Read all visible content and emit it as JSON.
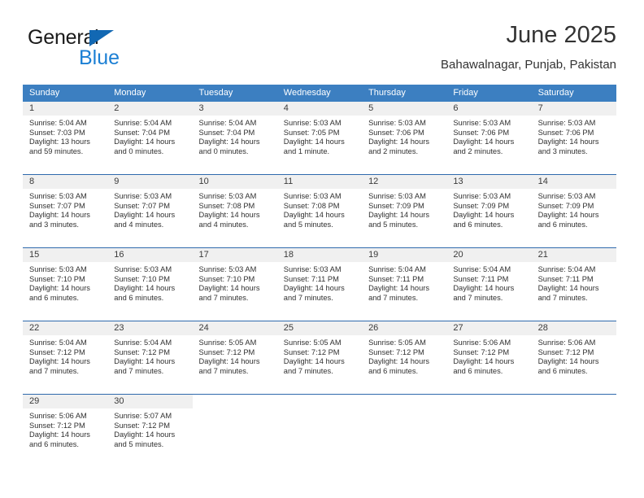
{
  "brand": {
    "name_part1": "General",
    "name_part2": "Blue",
    "triangle_color": "#1268b3",
    "blue_color": "#1b7fd4"
  },
  "header": {
    "title": "June 2025",
    "subtitle": "Bahawalnagar, Punjab, Pakistan"
  },
  "theme": {
    "header_bg": "#3c7fc1",
    "row_divider": "#2f6aad",
    "daynum_band": "#f0f0f0"
  },
  "weekdays": [
    "Sunday",
    "Monday",
    "Tuesday",
    "Wednesday",
    "Thursday",
    "Friday",
    "Saturday"
  ],
  "weeks": [
    [
      {
        "day": "1",
        "sunrise": "Sunrise: 5:04 AM",
        "sunset": "Sunset: 7:03 PM",
        "daylight1": "Daylight: 13 hours",
        "daylight2": "and 59 minutes."
      },
      {
        "day": "2",
        "sunrise": "Sunrise: 5:04 AM",
        "sunset": "Sunset: 7:04 PM",
        "daylight1": "Daylight: 14 hours",
        "daylight2": "and 0 minutes."
      },
      {
        "day": "3",
        "sunrise": "Sunrise: 5:04 AM",
        "sunset": "Sunset: 7:04 PM",
        "daylight1": "Daylight: 14 hours",
        "daylight2": "and 0 minutes."
      },
      {
        "day": "4",
        "sunrise": "Sunrise: 5:03 AM",
        "sunset": "Sunset: 7:05 PM",
        "daylight1": "Daylight: 14 hours",
        "daylight2": "and 1 minute."
      },
      {
        "day": "5",
        "sunrise": "Sunrise: 5:03 AM",
        "sunset": "Sunset: 7:06 PM",
        "daylight1": "Daylight: 14 hours",
        "daylight2": "and 2 minutes."
      },
      {
        "day": "6",
        "sunrise": "Sunrise: 5:03 AM",
        "sunset": "Sunset: 7:06 PM",
        "daylight1": "Daylight: 14 hours",
        "daylight2": "and 2 minutes."
      },
      {
        "day": "7",
        "sunrise": "Sunrise: 5:03 AM",
        "sunset": "Sunset: 7:06 PM",
        "daylight1": "Daylight: 14 hours",
        "daylight2": "and 3 minutes."
      }
    ],
    [
      {
        "day": "8",
        "sunrise": "Sunrise: 5:03 AM",
        "sunset": "Sunset: 7:07 PM",
        "daylight1": "Daylight: 14 hours",
        "daylight2": "and 3 minutes."
      },
      {
        "day": "9",
        "sunrise": "Sunrise: 5:03 AM",
        "sunset": "Sunset: 7:07 PM",
        "daylight1": "Daylight: 14 hours",
        "daylight2": "and 4 minutes."
      },
      {
        "day": "10",
        "sunrise": "Sunrise: 5:03 AM",
        "sunset": "Sunset: 7:08 PM",
        "daylight1": "Daylight: 14 hours",
        "daylight2": "and 4 minutes."
      },
      {
        "day": "11",
        "sunrise": "Sunrise: 5:03 AM",
        "sunset": "Sunset: 7:08 PM",
        "daylight1": "Daylight: 14 hours",
        "daylight2": "and 5 minutes."
      },
      {
        "day": "12",
        "sunrise": "Sunrise: 5:03 AM",
        "sunset": "Sunset: 7:09 PM",
        "daylight1": "Daylight: 14 hours",
        "daylight2": "and 5 minutes."
      },
      {
        "day": "13",
        "sunrise": "Sunrise: 5:03 AM",
        "sunset": "Sunset: 7:09 PM",
        "daylight1": "Daylight: 14 hours",
        "daylight2": "and 6 minutes."
      },
      {
        "day": "14",
        "sunrise": "Sunrise: 5:03 AM",
        "sunset": "Sunset: 7:09 PM",
        "daylight1": "Daylight: 14 hours",
        "daylight2": "and 6 minutes."
      }
    ],
    [
      {
        "day": "15",
        "sunrise": "Sunrise: 5:03 AM",
        "sunset": "Sunset: 7:10 PM",
        "daylight1": "Daylight: 14 hours",
        "daylight2": "and 6 minutes."
      },
      {
        "day": "16",
        "sunrise": "Sunrise: 5:03 AM",
        "sunset": "Sunset: 7:10 PM",
        "daylight1": "Daylight: 14 hours",
        "daylight2": "and 6 minutes."
      },
      {
        "day": "17",
        "sunrise": "Sunrise: 5:03 AM",
        "sunset": "Sunset: 7:10 PM",
        "daylight1": "Daylight: 14 hours",
        "daylight2": "and 7 minutes."
      },
      {
        "day": "18",
        "sunrise": "Sunrise: 5:03 AM",
        "sunset": "Sunset: 7:11 PM",
        "daylight1": "Daylight: 14 hours",
        "daylight2": "and 7 minutes."
      },
      {
        "day": "19",
        "sunrise": "Sunrise: 5:04 AM",
        "sunset": "Sunset: 7:11 PM",
        "daylight1": "Daylight: 14 hours",
        "daylight2": "and 7 minutes."
      },
      {
        "day": "20",
        "sunrise": "Sunrise: 5:04 AM",
        "sunset": "Sunset: 7:11 PM",
        "daylight1": "Daylight: 14 hours",
        "daylight2": "and 7 minutes."
      },
      {
        "day": "21",
        "sunrise": "Sunrise: 5:04 AM",
        "sunset": "Sunset: 7:11 PM",
        "daylight1": "Daylight: 14 hours",
        "daylight2": "and 7 minutes."
      }
    ],
    [
      {
        "day": "22",
        "sunrise": "Sunrise: 5:04 AM",
        "sunset": "Sunset: 7:12 PM",
        "daylight1": "Daylight: 14 hours",
        "daylight2": "and 7 minutes."
      },
      {
        "day": "23",
        "sunrise": "Sunrise: 5:04 AM",
        "sunset": "Sunset: 7:12 PM",
        "daylight1": "Daylight: 14 hours",
        "daylight2": "and 7 minutes."
      },
      {
        "day": "24",
        "sunrise": "Sunrise: 5:05 AM",
        "sunset": "Sunset: 7:12 PM",
        "daylight1": "Daylight: 14 hours",
        "daylight2": "and 7 minutes."
      },
      {
        "day": "25",
        "sunrise": "Sunrise: 5:05 AM",
        "sunset": "Sunset: 7:12 PM",
        "daylight1": "Daylight: 14 hours",
        "daylight2": "and 7 minutes."
      },
      {
        "day": "26",
        "sunrise": "Sunrise: 5:05 AM",
        "sunset": "Sunset: 7:12 PM",
        "daylight1": "Daylight: 14 hours",
        "daylight2": "and 6 minutes."
      },
      {
        "day": "27",
        "sunrise": "Sunrise: 5:06 AM",
        "sunset": "Sunset: 7:12 PM",
        "daylight1": "Daylight: 14 hours",
        "daylight2": "and 6 minutes."
      },
      {
        "day": "28",
        "sunrise": "Sunrise: 5:06 AM",
        "sunset": "Sunset: 7:12 PM",
        "daylight1": "Daylight: 14 hours",
        "daylight2": "and 6 minutes."
      }
    ],
    [
      {
        "day": "29",
        "sunrise": "Sunrise: 5:06 AM",
        "sunset": "Sunset: 7:12 PM",
        "daylight1": "Daylight: 14 hours",
        "daylight2": "and 6 minutes."
      },
      {
        "day": "30",
        "sunrise": "Sunrise: 5:07 AM",
        "sunset": "Sunset: 7:12 PM",
        "daylight1": "Daylight: 14 hours",
        "daylight2": "and 5 minutes."
      },
      {
        "day": "",
        "sunrise": "",
        "sunset": "",
        "daylight1": "",
        "daylight2": ""
      },
      {
        "day": "",
        "sunrise": "",
        "sunset": "",
        "daylight1": "",
        "daylight2": ""
      },
      {
        "day": "",
        "sunrise": "",
        "sunset": "",
        "daylight1": "",
        "daylight2": ""
      },
      {
        "day": "",
        "sunrise": "",
        "sunset": "",
        "daylight1": "",
        "daylight2": ""
      },
      {
        "day": "",
        "sunrise": "",
        "sunset": "",
        "daylight1": "",
        "daylight2": ""
      }
    ]
  ]
}
